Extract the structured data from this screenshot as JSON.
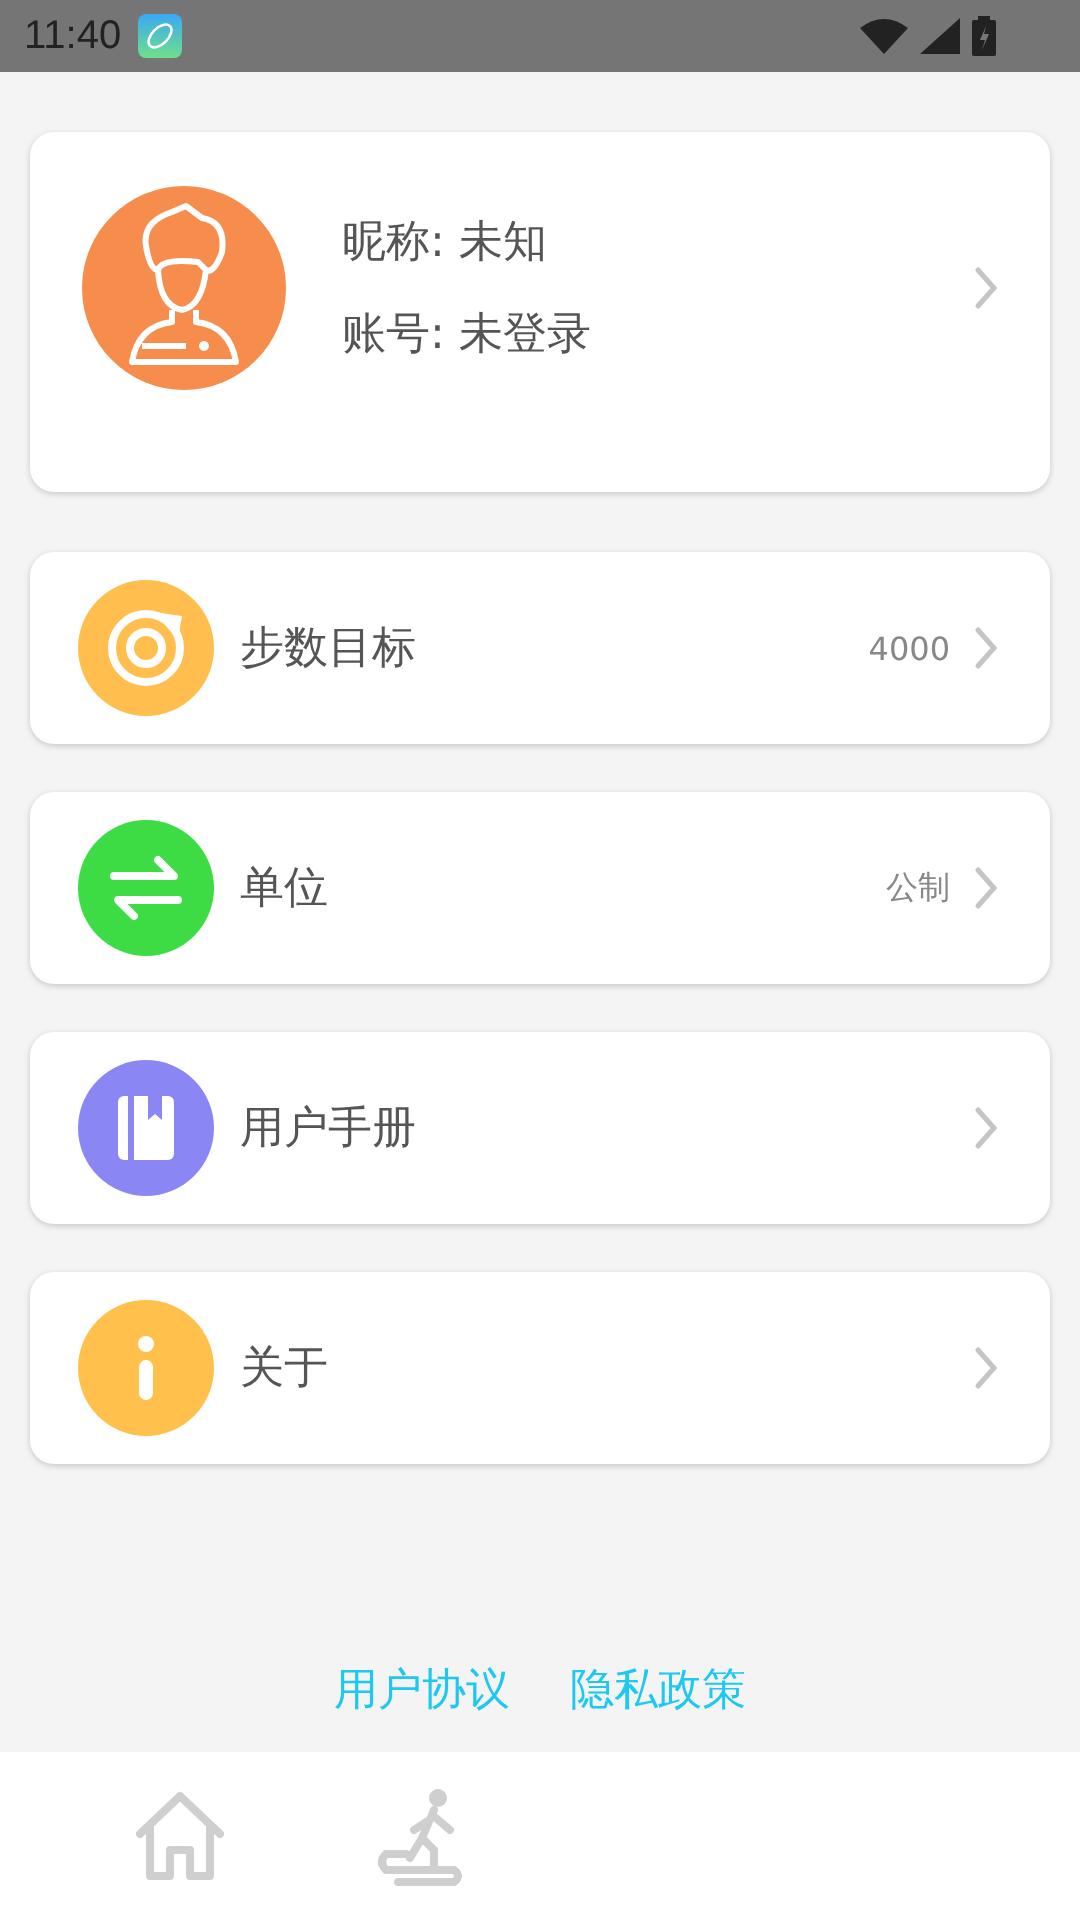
{
  "status_bar": {
    "time": "11:40"
  },
  "profile": {
    "nickname": "昵称: 未知",
    "account": "账号: 未登录"
  },
  "menu": [
    {
      "kind": "steps",
      "color": "#ffbe4d",
      "label": "步数目标",
      "value": "4000"
    },
    {
      "kind": "units",
      "color": "#3ddc44",
      "label": "单位",
      "value": "公制"
    },
    {
      "kind": "manual",
      "color": "#8a87f5",
      "label": "用户手册"
    },
    {
      "kind": "about",
      "color": "#ffc04c",
      "label": "关于"
    }
  ],
  "footer_links": [
    "用户协议",
    "隐私政策"
  ],
  "bottom_nav": [
    {
      "kind": "home",
      "selected": false
    },
    {
      "kind": "walk",
      "selected": false
    }
  ]
}
